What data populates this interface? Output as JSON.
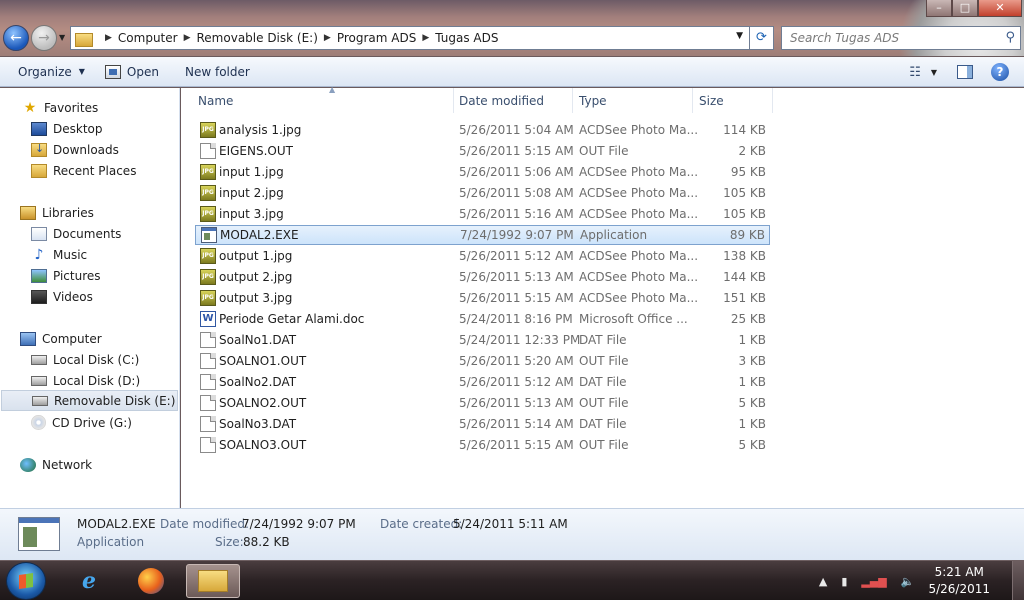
{
  "window": {
    "controls": {
      "minimize": "–",
      "maximize": "□",
      "close": "✕"
    }
  },
  "address": {
    "crumbs": [
      "Computer",
      "Removable Disk (E:)",
      "Program ADS",
      "Tugas ADS"
    ]
  },
  "search": {
    "placeholder": "Search Tugas ADS"
  },
  "toolbar": {
    "organize": "Organize",
    "open": "Open",
    "new_folder": "New folder"
  },
  "nav": {
    "favorites": "Favorites",
    "desktop": "Desktop",
    "downloads": "Downloads",
    "recent": "Recent Places",
    "libraries": "Libraries",
    "documents": "Documents",
    "music": "Music",
    "pictures": "Pictures",
    "videos": "Videos",
    "computer": "Computer",
    "local_c": "Local Disk (C:)",
    "local_d": "Local Disk (D:)",
    "removable_e": "Removable Disk (E:)",
    "cd_g": "CD Drive (G:)",
    "network": "Network"
  },
  "columns": {
    "name": "Name",
    "date": "Date modified",
    "type": "Type",
    "size": "Size"
  },
  "files": [
    {
      "name": "analysis 1.jpg",
      "date": "5/26/2011 5:04 AM",
      "type": "ACDSee Photo Ma...",
      "size": "114 KB",
      "icon": "jpg"
    },
    {
      "name": "EIGENS.OUT",
      "date": "5/26/2011 5:15 AM",
      "type": "OUT File",
      "size": "2 KB",
      "icon": "generic"
    },
    {
      "name": "input 1.jpg",
      "date": "5/26/2011 5:06 AM",
      "type": "ACDSee Photo Ma...",
      "size": "95 KB",
      "icon": "jpg"
    },
    {
      "name": "input 2.jpg",
      "date": "5/26/2011 5:08 AM",
      "type": "ACDSee Photo Ma...",
      "size": "105 KB",
      "icon": "jpg"
    },
    {
      "name": "input 3.jpg",
      "date": "5/26/2011 5:16 AM",
      "type": "ACDSee Photo Ma...",
      "size": "105 KB",
      "icon": "jpg"
    },
    {
      "name": "MODAL2.EXE",
      "date": "7/24/1992 9:07 PM",
      "type": "Application",
      "size": "89 KB",
      "icon": "exe"
    },
    {
      "name": "output 1.jpg",
      "date": "5/26/2011 5:12 AM",
      "type": "ACDSee Photo Ma...",
      "size": "138 KB",
      "icon": "jpg"
    },
    {
      "name": "output 2.jpg",
      "date": "5/26/2011 5:13 AM",
      "type": "ACDSee Photo Ma...",
      "size": "144 KB",
      "icon": "jpg"
    },
    {
      "name": "output 3.jpg",
      "date": "5/26/2011 5:15 AM",
      "type": "ACDSee Photo Ma...",
      "size": "151 KB",
      "icon": "jpg"
    },
    {
      "name": "Periode Getar  Alami.doc",
      "date": "5/24/2011 8:16 PM",
      "type": "Microsoft Office ...",
      "size": "25 KB",
      "icon": "doc"
    },
    {
      "name": "SoalNo1.DAT",
      "date": "5/24/2011 12:33 PM",
      "type": "DAT File",
      "size": "1 KB",
      "icon": "generic"
    },
    {
      "name": "SOALNO1.OUT",
      "date": "5/26/2011 5:20 AM",
      "type": "OUT File",
      "size": "3 KB",
      "icon": "generic"
    },
    {
      "name": "SoalNo2.DAT",
      "date": "5/26/2011 5:12 AM",
      "type": "DAT File",
      "size": "1 KB",
      "icon": "generic"
    },
    {
      "name": "SOALNO2.OUT",
      "date": "5/26/2011 5:13 AM",
      "type": "OUT File",
      "size": "5 KB",
      "icon": "generic"
    },
    {
      "name": "SoalNo3.DAT",
      "date": "5/26/2011 5:14 AM",
      "type": "DAT File",
      "size": "1 KB",
      "icon": "generic"
    },
    {
      "name": "SOALNO3.OUT",
      "date": "5/26/2011 5:15 AM",
      "type": "OUT File",
      "size": "5 KB",
      "icon": "generic"
    }
  ],
  "selected_index": 5,
  "details": {
    "name": "MODAL2.EXE",
    "type": "Application",
    "date_modified_label": "Date modified:",
    "date_modified": "7/24/1992 9:07 PM",
    "date_created_label": "Date created:",
    "date_created": "5/24/2011 5:11 AM",
    "size_label": "Size:",
    "size": "88.2 KB"
  },
  "taskbar": {
    "clock_time": "5:21 AM",
    "clock_date": "5/26/2011"
  },
  "icons": {
    "start": "windows-start-icon",
    "ie": "internet-explorer-icon",
    "firefox": "firefox-icon",
    "explorer": "windows-explorer-icon"
  }
}
